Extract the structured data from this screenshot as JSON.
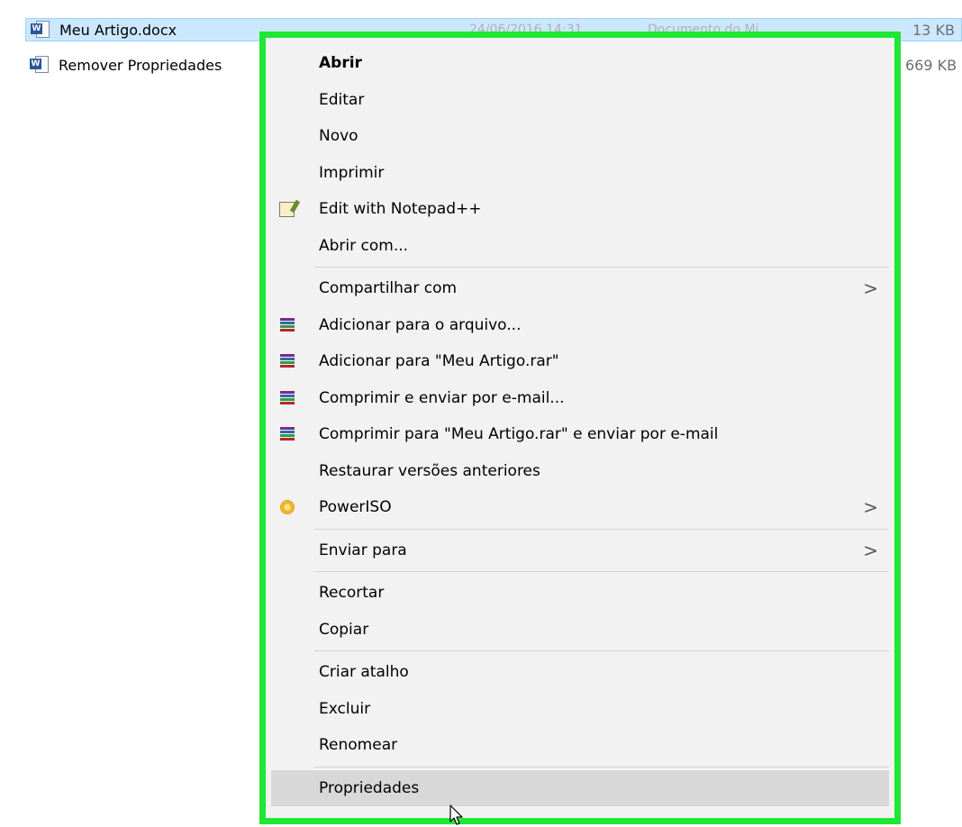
{
  "file_list": {
    "rows": [
      {
        "name": "Meu Artigo.docx",
        "date": "24/06/2016 14:31",
        "type": "Documento do Mi",
        "size": "13 KB",
        "selected": true
      },
      {
        "name": "Remover Propriedades",
        "size": "669 KB",
        "selected": false
      }
    ]
  },
  "context_menu": {
    "items": [
      {
        "label": "Abrir",
        "bold": true
      },
      {
        "label": "Editar"
      },
      {
        "label": "Novo"
      },
      {
        "label": "Imprimir"
      },
      {
        "label": "Edit with Notepad++",
        "icon": "notepad-plus-plus-icon"
      },
      {
        "label": "Abrir com..."
      },
      {
        "label": "Compartilhar com",
        "submenu": true
      },
      {
        "label": "Adicionar para o arquivo...",
        "icon": "winrar-icon"
      },
      {
        "label": "Adicionar para \"Meu Artigo.rar\"",
        "icon": "winrar-icon"
      },
      {
        "label": "Comprimir e enviar por e-mail...",
        "icon": "winrar-icon"
      },
      {
        "label": "Comprimir para \"Meu Artigo.rar\" e enviar por e-mail",
        "icon": "winrar-icon"
      },
      {
        "label": "Restaurar versões anteriores"
      },
      {
        "label": "PowerISO",
        "icon": "poweriso-icon",
        "submenu": true
      },
      {
        "label": "Enviar para",
        "submenu": true
      },
      {
        "label": "Recortar"
      },
      {
        "label": "Copiar"
      },
      {
        "label": "Criar atalho"
      },
      {
        "label": "Excluir"
      },
      {
        "label": "Renomear"
      },
      {
        "label": "Propriedades",
        "hovered": true
      }
    ],
    "submenu_arrow": ">",
    "highlight_color": "#20e635"
  }
}
